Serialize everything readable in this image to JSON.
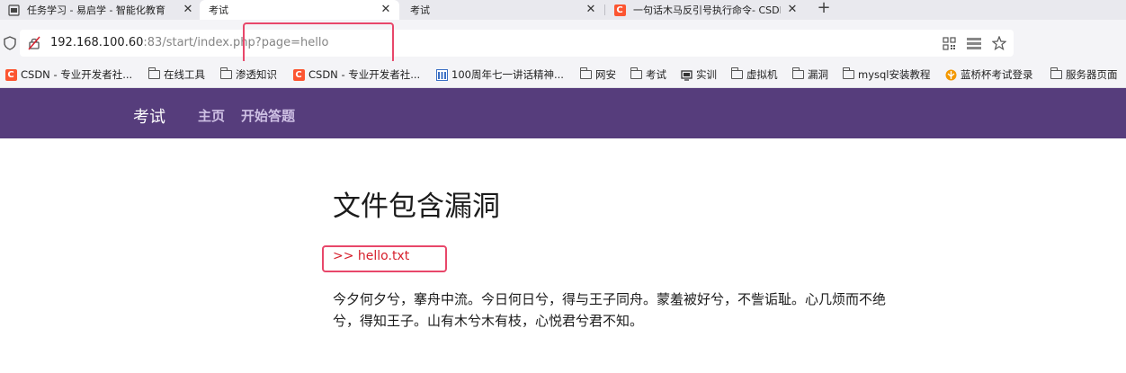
{
  "browser": {
    "tabs": [
      {
        "title": "任务学习 - 易启学 - 智能化教育",
        "active": false,
        "favicon": "school-page-icon"
      },
      {
        "title": "考试",
        "active": true,
        "favicon": ""
      },
      {
        "title": "考试",
        "active": false,
        "favicon": ""
      },
      {
        "title": "一句话木马反引号执行命令- CSDN",
        "active": false,
        "favicon": "csdn-icon"
      }
    ],
    "new_tab_label": "+",
    "close_label": "✕",
    "url": {
      "host": "192.168.100.60",
      "rest": ":83/start/index.php?page=hello"
    },
    "bookmarks": [
      {
        "label": "CSDN - 专业开发者社...",
        "icon": "csdn-icon"
      },
      {
        "label": "在线工具",
        "icon": "folder-icon"
      },
      {
        "label": "渗透知识",
        "icon": "folder-icon"
      },
      {
        "label": "CSDN - 专业开发者社...",
        "icon": "csdn-icon"
      },
      {
        "label": "100周年七一讲话精神...",
        "icon": "site-icon"
      },
      {
        "label": "网安",
        "icon": "folder-icon"
      },
      {
        "label": "考试",
        "icon": "folder-icon"
      },
      {
        "label": "实训",
        "icon": "site-icon"
      },
      {
        "label": "虚拟机",
        "icon": "folder-icon"
      },
      {
        "label": "漏洞",
        "icon": "folder-icon"
      },
      {
        "label": "mysql安装教程",
        "icon": "folder-icon"
      },
      {
        "label": "蓝桥杯考试登录",
        "icon": "lanqiao-icon"
      },
      {
        "label": "服务器页面",
        "icon": "folder-icon"
      }
    ],
    "colors": {
      "highlight": "#e8476a",
      "csdn": "#fc5531"
    }
  },
  "site": {
    "brand": "考试",
    "nav": [
      "主页",
      "开始答题"
    ],
    "navbar_color": "#563d7c"
  },
  "content": {
    "title": "文件包含漏洞",
    "include_line": ">> hello.txt",
    "poem": "今夕何夕兮，搴舟中流。今日何日兮，得与王子同舟。蒙羞被好兮，不訾诟耻。心几烦而不绝兮，得知王子。山有木兮木有枝，心悦君兮君不知。"
  }
}
